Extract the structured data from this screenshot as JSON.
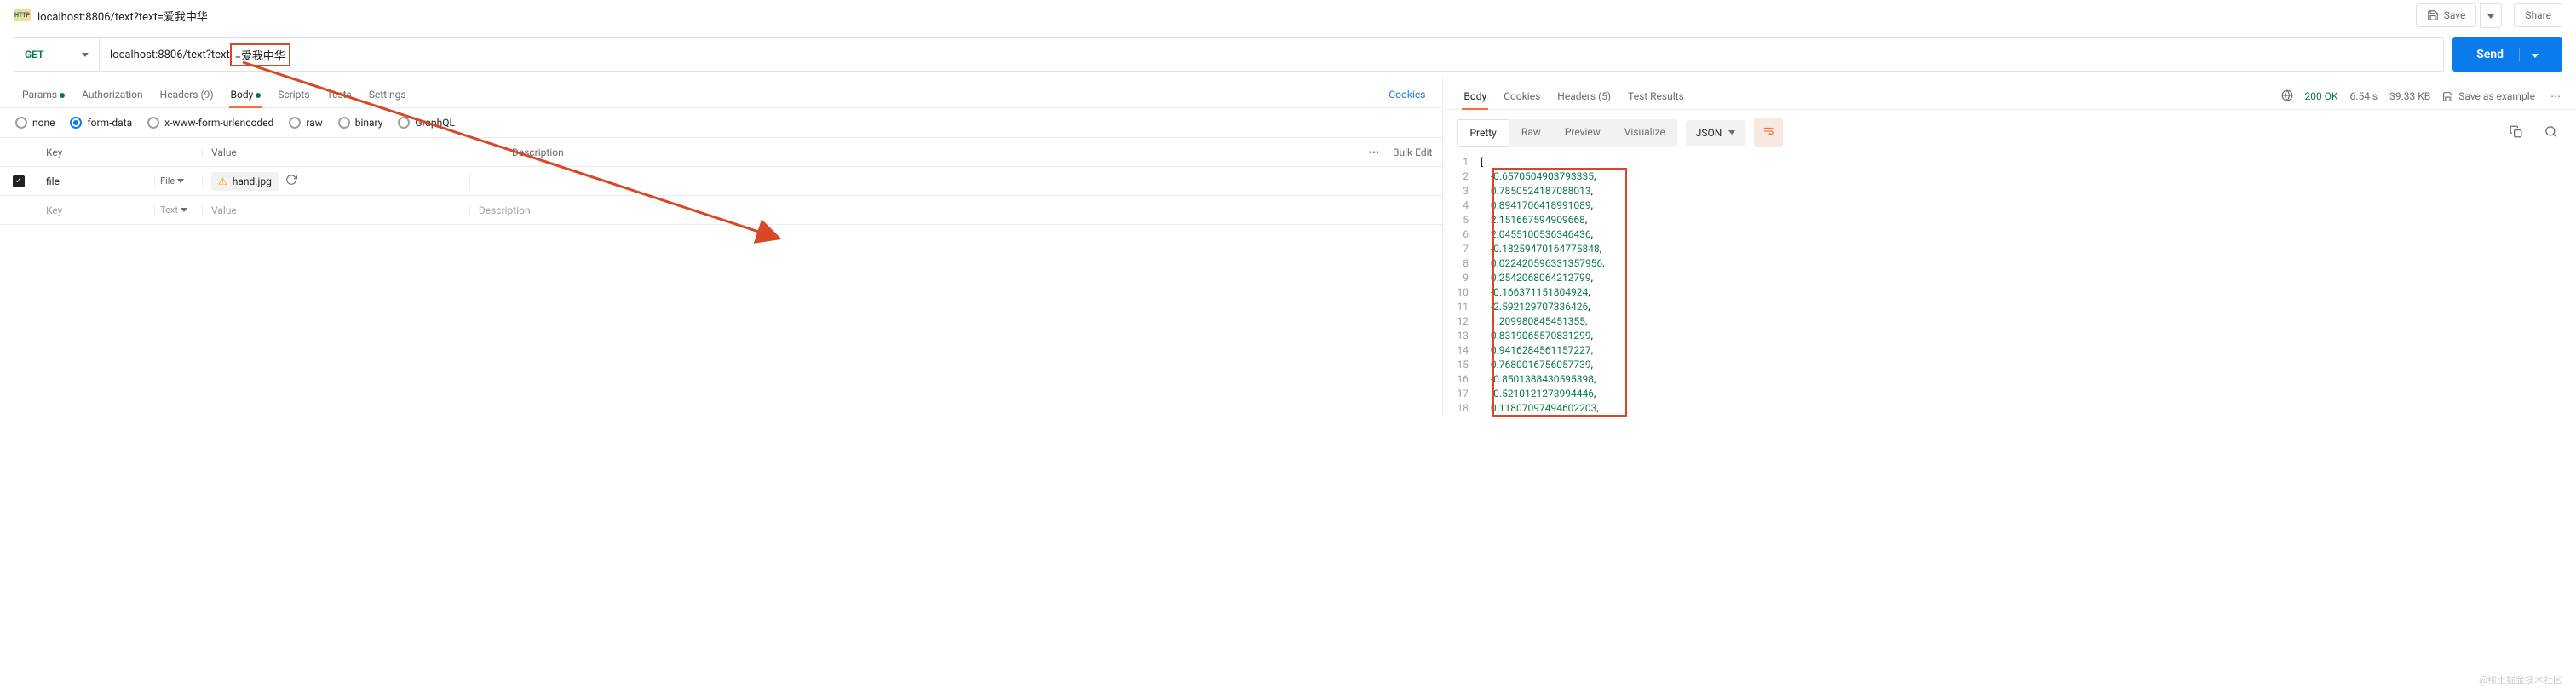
{
  "request": {
    "icon_label": "HTTP",
    "title": "localhost:8806/text?text=爱我中华",
    "save_label": "Save",
    "share_label": "Share"
  },
  "urlbar": {
    "method": "GET",
    "url_prefix": "localhost:8806/text?text",
    "url_highlight": "=爱我中华",
    "send_label": "Send"
  },
  "req_tabs": {
    "params": "Params",
    "auth": "Authorization",
    "headers": "Headers (9)",
    "body": "Body",
    "scripts": "Scripts",
    "tests": "Tests",
    "settings": "Settings",
    "cookies": "Cookies"
  },
  "body_types": {
    "none": "none",
    "form_data": "form-data",
    "urlencoded": "x-www-form-urlencoded",
    "raw": "raw",
    "binary": "binary",
    "graphql": "GraphQL"
  },
  "kv": {
    "key_header": "Key",
    "value_header": "Value",
    "desc_header": "Description",
    "bulk_edit": "Bulk Edit",
    "rows": [
      {
        "key": "file",
        "type": "File",
        "file": "hand.jpg"
      }
    ],
    "placeholder_key": "Key",
    "placeholder_type": "Text",
    "placeholder_value": "Value",
    "placeholder_desc": "Description"
  },
  "resp_tabs": {
    "body": "Body",
    "cookies": "Cookies",
    "headers": "Headers (5)",
    "test_results": "Test Results"
  },
  "resp_meta": {
    "status": "200 OK",
    "time": "6.54 s",
    "size": "39.33 KB",
    "save_as": "Save as example"
  },
  "resp_toolbar": {
    "pretty": "Pretty",
    "raw": "Raw",
    "preview": "Preview",
    "visualize": "Visualize",
    "format": "JSON"
  },
  "code_lines": [
    "[",
    "    -0.6570504903793335,",
    "    0.7850524187088013,",
    "    0.8941706418991089,",
    "    2.151667594909668,",
    "    2.0455100536346436,",
    "    -0.18259470164775848,",
    "    0.022420596331357956,",
    "    0.2542068064212799,",
    "    -0.166371151804924,",
    "    -2.592129707336426,",
    "    1.209980845451355,",
    "    0.8319065570831299,",
    "    0.9416284561157227,",
    "    0.7680016756057739,",
    "    -0.8501388430595398,",
    "    -0.5210121273994446,",
    "    0.11807097494602203,"
  ],
  "watermark": "@稀土掘金技术社区"
}
